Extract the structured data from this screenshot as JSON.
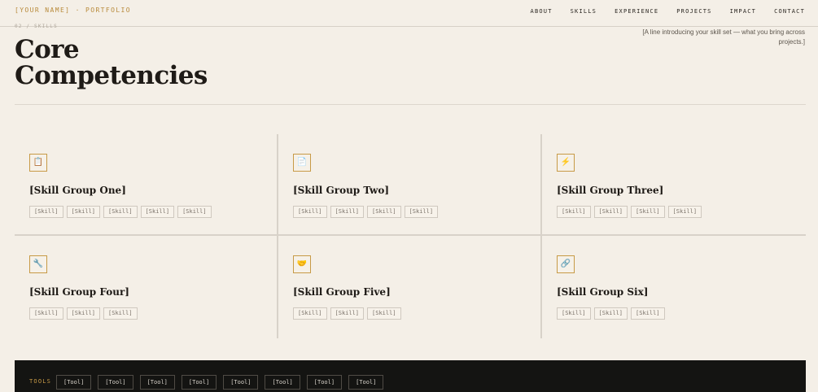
{
  "header": {
    "brand": "[YOUR NAME] · PORTFOLIO",
    "nav": [
      "ABOUT",
      "SKILLS",
      "EXPERIENCE",
      "PROJECTS",
      "IMPACT",
      "CONTACT"
    ]
  },
  "section": {
    "breadcrumb": "02 / SKILLS",
    "title_line1": "Core",
    "title_line2": "Competencies",
    "intro": "[A line introducing your skill set — what you bring across projects.]"
  },
  "groups": [
    {
      "title": "[Skill Group One]",
      "icon": "clipboard-icon",
      "glyph": "📋",
      "skills": [
        "[Skill]",
        "[Skill]",
        "[Skill]",
        "[Skill]",
        "[Skill]"
      ]
    },
    {
      "title": "[Skill Group Two]",
      "icon": "document-icon",
      "glyph": "📄",
      "skills": [
        "[Skill]",
        "[Skill]",
        "[Skill]",
        "[Skill]"
      ]
    },
    {
      "title": "[Skill Group Three]",
      "icon": "lightning-icon",
      "glyph": "⚡",
      "skills": [
        "[Skill]",
        "[Skill]",
        "[Skill]",
        "[Skill]"
      ]
    },
    {
      "title": "[Skill Group Four]",
      "icon": "wrench-icon",
      "glyph": "🔧",
      "skills": [
        "[Skill]",
        "[Skill]",
        "[Skill]"
      ]
    },
    {
      "title": "[Skill Group Five]",
      "icon": "handshake-icon",
      "glyph": "🤝",
      "skills": [
        "[Skill]",
        "[Skill]",
        "[Skill]"
      ]
    },
    {
      "title": "[Skill Group Six]",
      "icon": "link-icon",
      "glyph": "🔗",
      "skills": [
        "[Skill]",
        "[Skill]",
        "[Skill]"
      ]
    }
  ],
  "tools": {
    "label": "TOOLS",
    "items": [
      "[Tool]",
      "[Tool]",
      "[Tool]",
      "[Tool]",
      "[Tool]",
      "[Tool]",
      "[Tool]",
      "[Tool]"
    ]
  },
  "colors": {
    "background": "#f4efe7",
    "accent": "#c79a46",
    "text": "#1f1b17",
    "tools_background": "#141412"
  }
}
